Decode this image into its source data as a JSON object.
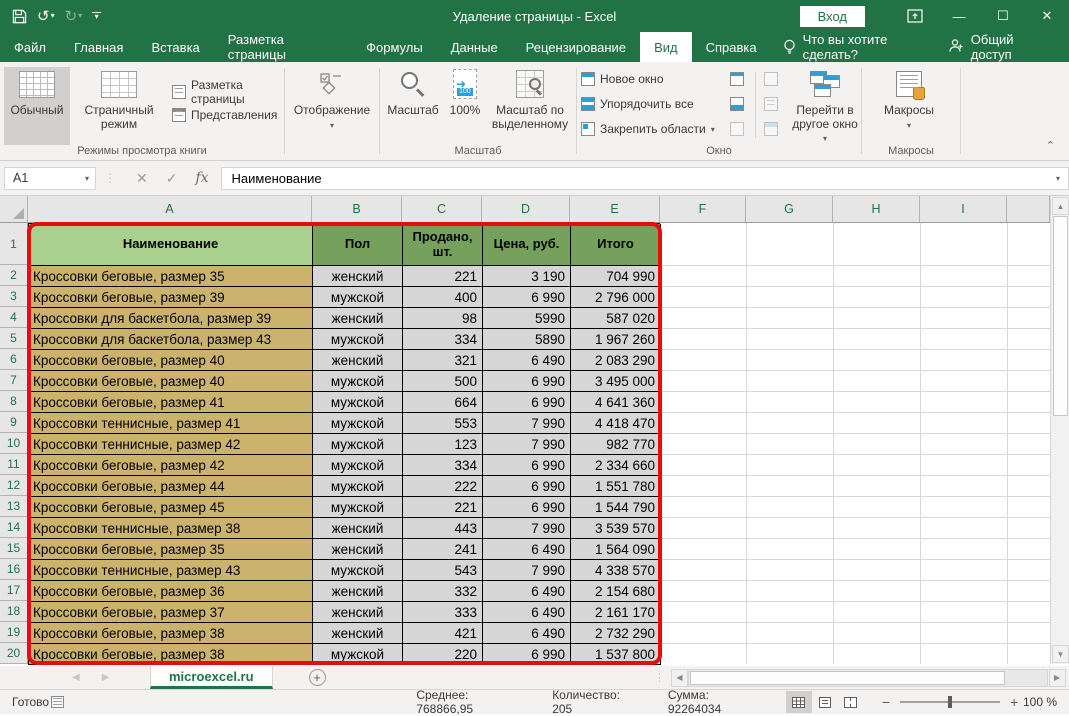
{
  "title_bar": {
    "title": "Удаление страницы  -  Excel",
    "sign_in": "Вход"
  },
  "tabbar": {
    "tabs": [
      {
        "label": "Файл"
      },
      {
        "label": "Главная"
      },
      {
        "label": "Вставка"
      },
      {
        "label": "Разметка страницы"
      },
      {
        "label": "Формулы"
      },
      {
        "label": "Данные"
      },
      {
        "label": "Рецензирование"
      },
      {
        "label": "Вид"
      },
      {
        "label": "Справка"
      }
    ],
    "tell_me": "Что вы хотите сделать?",
    "share": "Общий доступ"
  },
  "ribbon": {
    "views_group": {
      "label": "Режимы просмотра книги",
      "normal": "Обычный",
      "page_break_preview": "Страничный режим",
      "page_layout": "Разметка страницы",
      "custom_views": "Представления"
    },
    "show_button": "Отображение",
    "zoom_group": {
      "label": "Масштаб",
      "zoom": "Масштаб",
      "hundred": "100%",
      "zoom_to_selection": "Масштаб по выделенному"
    },
    "window_group": {
      "label": "Окно",
      "new_window": "Новое окно",
      "arrange_all": "Упорядочить все",
      "freeze_panes": "Закрепить области",
      "switch_windows": "Перейти в другое окно"
    },
    "macros_group": {
      "label": "Макросы",
      "macros": "Макросы"
    }
  },
  "formula_bar": {
    "name_box": "A1",
    "content": "Наименование"
  },
  "grid": {
    "columns": [
      "A",
      "B",
      "C",
      "D",
      "E",
      "F",
      "G",
      "H",
      "I",
      ""
    ],
    "row_count": 20
  },
  "table": {
    "headers": [
      "Наименование",
      "Пол",
      "Продано, шт.",
      "Цена, руб.",
      "Итого"
    ],
    "rows": [
      [
        "Кроссовки беговые, размер 35",
        "женский",
        "221",
        "3 190",
        "704 990"
      ],
      [
        "Кроссовки беговые, размер 39",
        "мужской",
        "400",
        "6 990",
        "2 796 000"
      ],
      [
        "Кроссовки для баскетбола, размер 39",
        "женский",
        "98",
        "5990",
        "587 020"
      ],
      [
        "Кроссовки для баскетбола, размер 43",
        "мужской",
        "334",
        "5890",
        "1 967 260"
      ],
      [
        "Кроссовки беговые, размер 40",
        "женский",
        "321",
        "6 490",
        "2 083 290"
      ],
      [
        "Кроссовки беговые, размер 40",
        "мужской",
        "500",
        "6 990",
        "3 495 000"
      ],
      [
        "Кроссовки беговые, размер 41",
        "мужской",
        "664",
        "6 990",
        "4 641 360"
      ],
      [
        "Кроссовки теннисные, размер 41",
        "мужской",
        "553",
        "7 990",
        "4 418 470"
      ],
      [
        "Кроссовки теннисные, размер 42",
        "мужской",
        "123",
        "7 990",
        "982 770"
      ],
      [
        "Кроссовки беговые, размер 42",
        "мужской",
        "334",
        "6 990",
        "2 334 660"
      ],
      [
        "Кроссовки беговые, размер 44",
        "мужской",
        "222",
        "6 990",
        "1 551 780"
      ],
      [
        "Кроссовки беговые, размер 45",
        "мужской",
        "221",
        "6 990",
        "1 544 790"
      ],
      [
        "Кроссовки теннисные, размер 38",
        "женский",
        "443",
        "7 990",
        "3 539 570"
      ],
      [
        "Кроссовки беговые, размер 35",
        "женский",
        "241",
        "6 490",
        "1 564 090"
      ],
      [
        "Кроссовки теннисные, размер 43",
        "мужской",
        "543",
        "7 990",
        "4 338 570"
      ],
      [
        "Кроссовки беговые, размер 36",
        "женский",
        "332",
        "6 490",
        "2 154 680"
      ],
      [
        "Кроссовки беговые, размер 37",
        "женский",
        "333",
        "6 490",
        "2 161 170"
      ],
      [
        "Кроссовки беговые, размер 38",
        "женский",
        "421",
        "6 490",
        "2 732 290"
      ],
      [
        "Кроссовки беговые, размер 38",
        "мужской",
        "220",
        "6 990",
        "1 537 800"
      ]
    ]
  },
  "sheet_bar": {
    "tab": "microexcel.ru"
  },
  "status_bar": {
    "ready": "Готово",
    "average": "Среднее: 768866,95",
    "count": "Количество: 205",
    "sum": "Сумма: 92264034",
    "zoom": "100 %"
  },
  "colors": {
    "excel_green": "#217346",
    "header_a_fill": "#a9d08e",
    "header_bcde_fill": "#76a15c",
    "column_a_fill": "#cbb26d",
    "data_fill": "#d6d6d6",
    "annotation_red": "#e60d0d"
  }
}
